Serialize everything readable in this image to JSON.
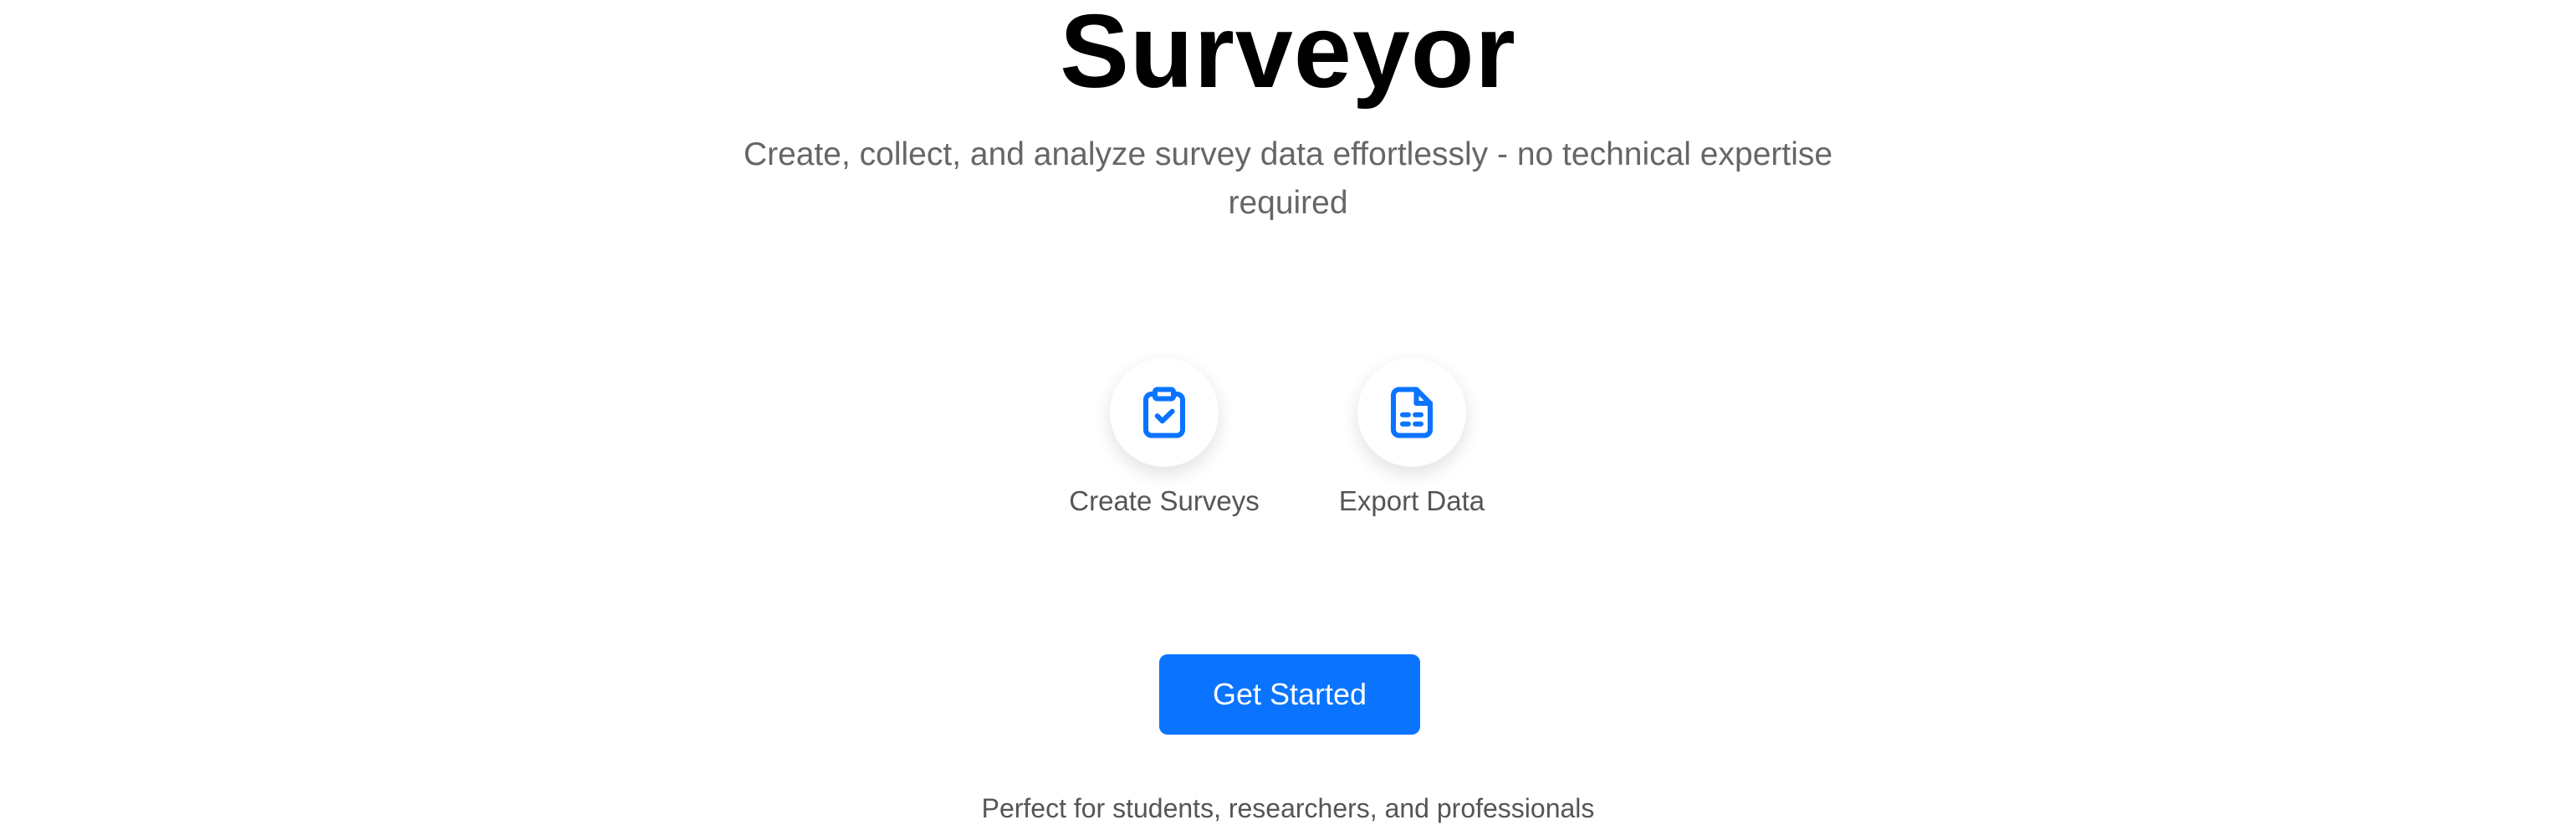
{
  "hero": {
    "title": "Surveyor",
    "subtitle": "Create, collect, and analyze survey data effortlessly - no technical expertise required"
  },
  "features": [
    {
      "label": "Create Surveys",
      "icon": "clipboard-check-icon"
    },
    {
      "label": "Export Data",
      "icon": "file-spreadsheet-icon"
    }
  ],
  "cta": {
    "label": "Get Started"
  },
  "footer": {
    "tagline": "Perfect for students, researchers, and professionals"
  },
  "colors": {
    "accent": "#0a74ff",
    "title": "#000000",
    "muted_text": "#666666"
  }
}
